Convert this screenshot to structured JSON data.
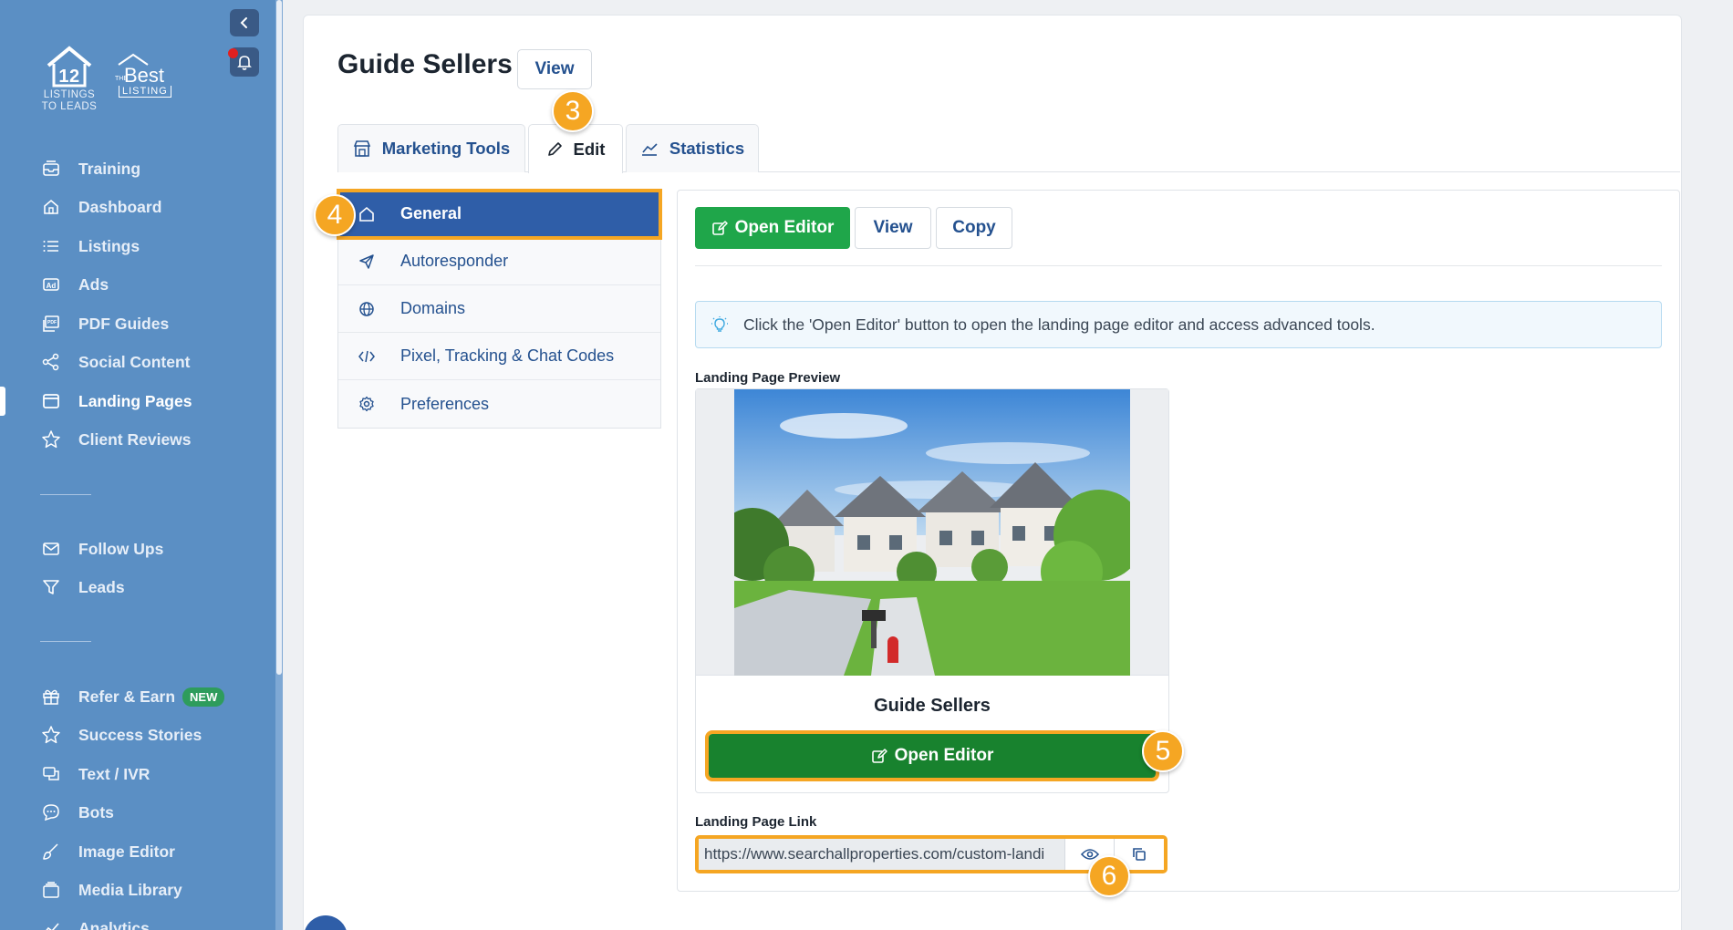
{
  "sidebar": {
    "logo_primary_lines": [
      "LISTINGS",
      "TO LEADS"
    ],
    "logo_primary_number": "12",
    "logo_secondary": {
      "the": "THE",
      "best": "Best",
      "listing": "LISTING"
    },
    "group1": [
      {
        "label": "Training",
        "icon": "inbox-icon"
      },
      {
        "label": "Dashboard",
        "icon": "home-icon"
      },
      {
        "label": "Listings",
        "icon": "list-icon"
      },
      {
        "label": "Ads",
        "icon": "ad-icon"
      },
      {
        "label": "PDF Guides",
        "icon": "pdf-icon"
      },
      {
        "label": "Social Content",
        "icon": "share-icon"
      },
      {
        "label": "Landing Pages",
        "icon": "window-icon",
        "active": true
      },
      {
        "label": "Client Reviews",
        "icon": "star-icon"
      }
    ],
    "group2": [
      {
        "label": "Follow Ups",
        "icon": "mail-icon"
      },
      {
        "label": "Leads",
        "icon": "funnel-icon"
      }
    ],
    "group3": [
      {
        "label": "Refer & Earn",
        "icon": "gift-icon",
        "badge": "NEW"
      },
      {
        "label": "Success Stories",
        "icon": "star-icon"
      },
      {
        "label": "Text / IVR",
        "icon": "chat-icon"
      },
      {
        "label": "Bots",
        "icon": "bot-icon"
      },
      {
        "label": "Image Editor",
        "icon": "brush-icon"
      },
      {
        "label": "Media Library",
        "icon": "folder-icon"
      },
      {
        "label": "Analytics",
        "icon": "chart-icon"
      }
    ]
  },
  "header": {
    "title": "Guide Sellers",
    "view_label": "View"
  },
  "tabs": [
    {
      "label": "Marketing Tools",
      "icon": "store-icon"
    },
    {
      "label": "Edit",
      "icon": "pencil-icon",
      "active": true
    },
    {
      "label": "Statistics",
      "icon": "chart-line-icon"
    }
  ],
  "submenu": [
    {
      "label": "General",
      "icon": "home-icon",
      "active": true
    },
    {
      "label": "Autoresponder",
      "icon": "send-icon"
    },
    {
      "label": "Domains",
      "icon": "globe-icon"
    },
    {
      "label": "Pixel, Tracking & Chat Codes",
      "icon": "code-icon"
    },
    {
      "label": "Preferences",
      "icon": "gear-icon"
    }
  ],
  "toolbar": {
    "open_editor": "Open Editor",
    "view": "View",
    "copy": "Copy"
  },
  "info": "Click the 'Open Editor' button to open the landing page editor and access advanced tools.",
  "preview": {
    "label": "Landing Page Preview",
    "name": "Guide Sellers",
    "open_editor": "Open Editor"
  },
  "link": {
    "label": "Landing Page Link",
    "value": "https://www.searchallproperties.com/custom-landi"
  },
  "callouts": [
    "3",
    "4",
    "5",
    "6"
  ],
  "colors": {
    "sidebar": "#5b8fc4",
    "accent_blue": "#24518f",
    "active_item": "#2f5ea8",
    "green": "#1fa64a",
    "green_dark": "#18822e",
    "callout": "#f5a623"
  }
}
